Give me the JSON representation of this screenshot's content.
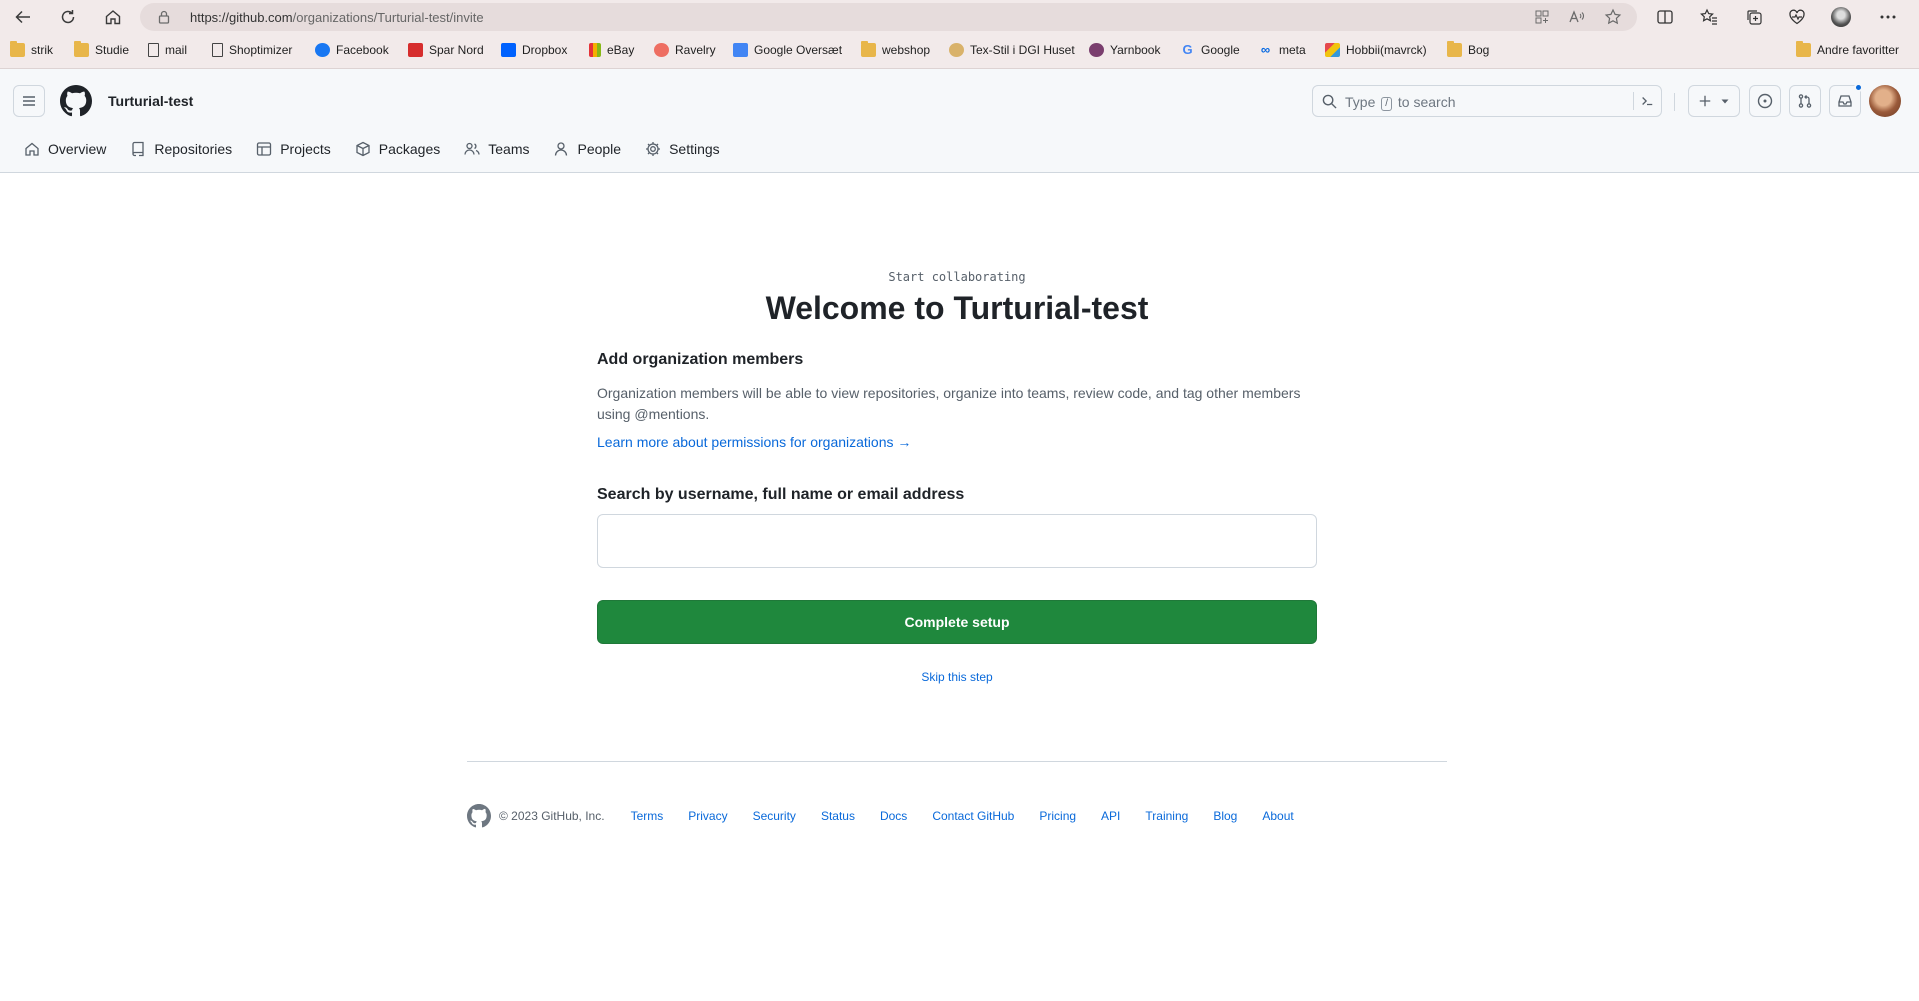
{
  "browser": {
    "url_host": "https://github.com",
    "url_path": "/organizations/Turturial-test/invite",
    "bookmarks": [
      {
        "label": "strik",
        "icon": "folder-icon"
      },
      {
        "label": "Studie",
        "icon": "folder-icon"
      },
      {
        "label": "mail",
        "icon": "page-icon"
      },
      {
        "label": "Shoptimizer",
        "icon": "page-icon"
      },
      {
        "label": "Facebook",
        "icon": "facebook-icon"
      },
      {
        "label": "Spar Nord",
        "icon": "spar-nord-icon"
      },
      {
        "label": "Dropbox",
        "icon": "dropbox-icon"
      },
      {
        "label": "eBay",
        "icon": "ebay-icon"
      },
      {
        "label": "Ravelry",
        "icon": "ravelry-icon"
      },
      {
        "label": "Google Oversæt",
        "icon": "google-translate-icon"
      },
      {
        "label": "webshop",
        "icon": "folder-icon"
      },
      {
        "label": "Tex-Stil i DGI Huset",
        "icon": "tex-stil-icon"
      },
      {
        "label": "Yarnbook",
        "icon": "yarnbook-icon"
      },
      {
        "label": "Google",
        "icon": "google-icon"
      },
      {
        "label": "meta",
        "icon": "meta-icon"
      },
      {
        "label": "Hobbii(mavrck)",
        "icon": "hobbii-icon"
      },
      {
        "label": "Bog",
        "icon": "folder-icon"
      }
    ],
    "other_favorites": "Andre favoritter"
  },
  "header": {
    "org_name": "Turturial-test",
    "search_prefix": "Type",
    "search_key": "/",
    "search_suffix": "to search"
  },
  "org_tabs": [
    {
      "label": "Overview",
      "icon": "home-icon"
    },
    {
      "label": "Repositories",
      "icon": "repo-icon"
    },
    {
      "label": "Projects",
      "icon": "table-icon"
    },
    {
      "label": "Packages",
      "icon": "package-icon"
    },
    {
      "label": "Teams",
      "icon": "people-icon"
    },
    {
      "label": "People",
      "icon": "person-icon"
    },
    {
      "label": "Settings",
      "icon": "gear-icon"
    }
  ],
  "main": {
    "kicker": "Start collaborating",
    "title": "Welcome to Turturial-test",
    "section_title": "Add organization members",
    "description": "Organization members will be able to view repositories, organize into teams, review code, and tag other members using @mentions.",
    "learn_more": "Learn more about permissions for organizations →",
    "search_label": "Search by username, full name or email address",
    "search_value": "",
    "complete_button": "Complete setup",
    "skip_link": "Skip this step"
  },
  "footer": {
    "copyright": "© 2023 GitHub, Inc.",
    "links": [
      "Terms",
      "Privacy",
      "Security",
      "Status",
      "Docs",
      "Contact GitHub",
      "Pricing",
      "API",
      "Training",
      "Blog",
      "About"
    ]
  },
  "colors": {
    "primary_button": "#1f883d",
    "link": "#0969da",
    "header_bg": "#f6f8fa",
    "browser_bg": "#f2eaea"
  }
}
